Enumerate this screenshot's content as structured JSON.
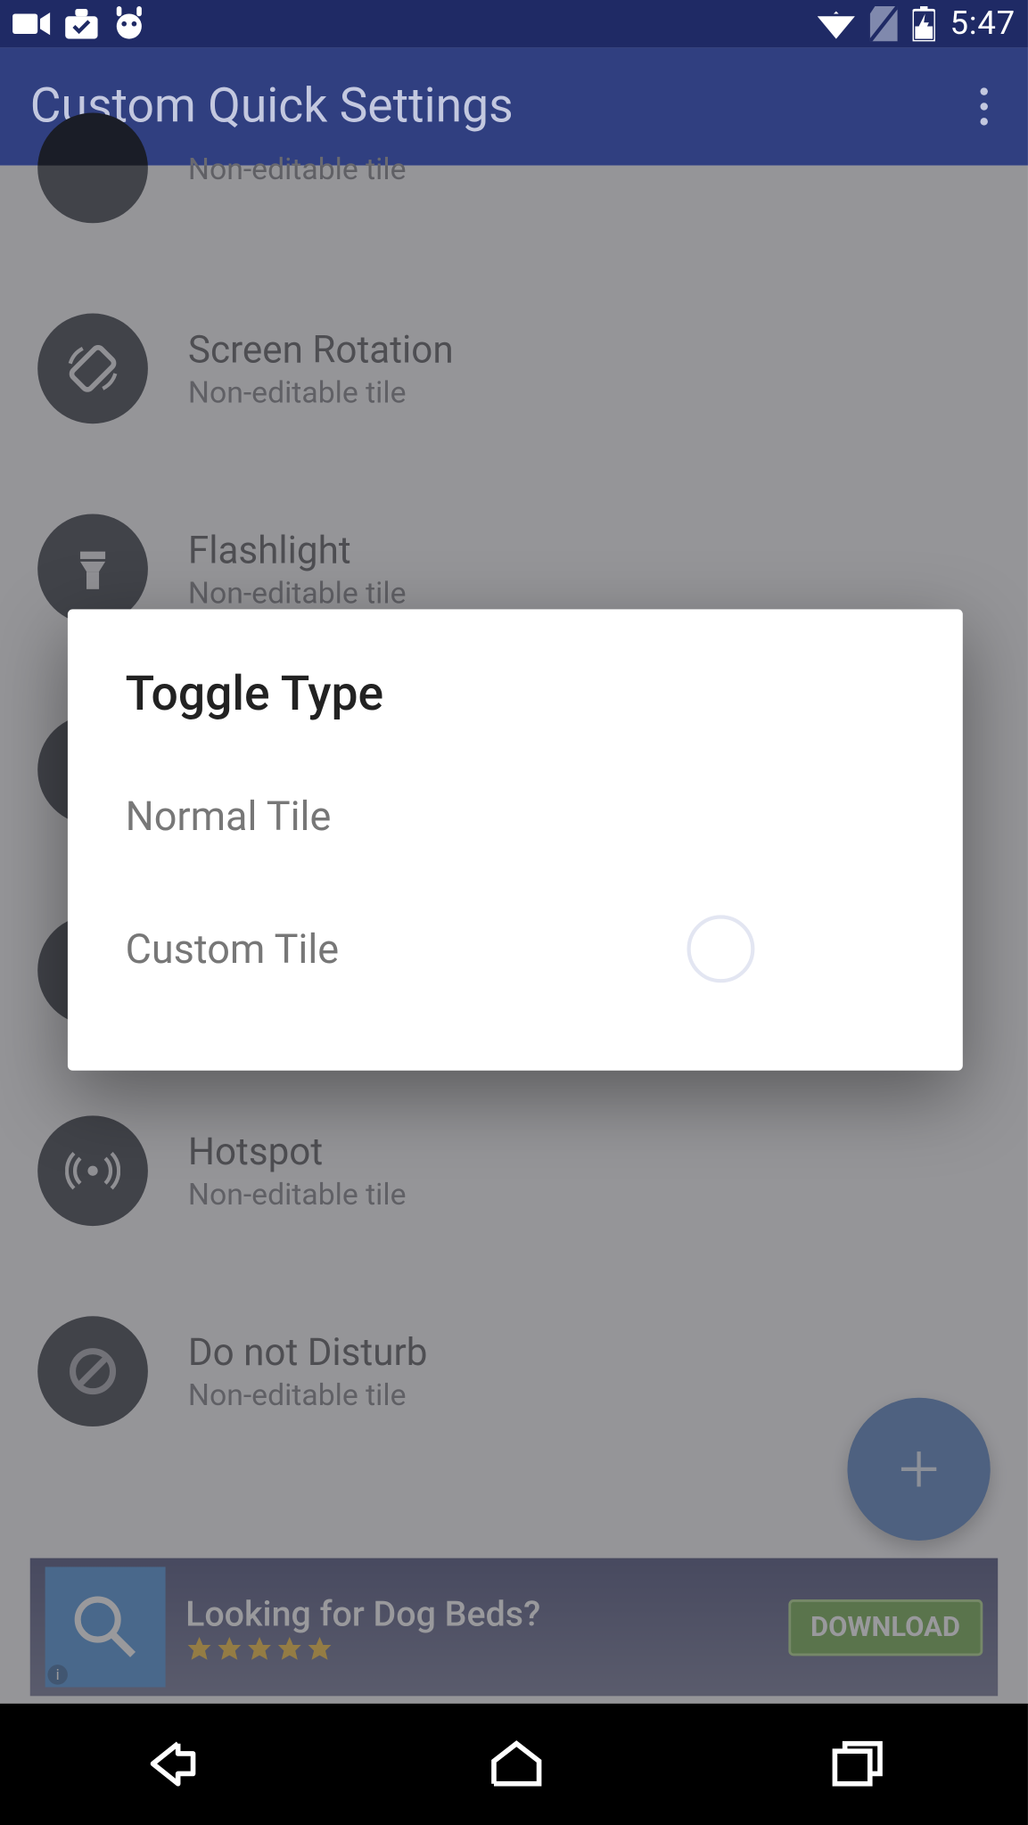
{
  "statusbar": {
    "time": "5:47"
  },
  "appbar": {
    "title": "Custom Quick Settings"
  },
  "tiles": [
    {
      "title": "",
      "sub": "Non-editable tile",
      "icon": "circle"
    },
    {
      "title": "Screen Rotation",
      "sub": "Non-editable tile",
      "icon": "rotate"
    },
    {
      "title": "Flashlight",
      "sub": "Non-editable tile",
      "icon": "flashlight"
    },
    {
      "title": "",
      "sub": "",
      "icon": "circle"
    },
    {
      "title": "",
      "sub": "",
      "icon": "circle"
    },
    {
      "title": "Hotspot",
      "sub": "Non-editable tile",
      "icon": "hotspot"
    },
    {
      "title": "Do not Disturb",
      "sub": "Non-editable tile",
      "icon": "dnd"
    }
  ],
  "dialog": {
    "title": "Toggle Type",
    "options": [
      "Normal Tile",
      "Custom Tile"
    ]
  },
  "ad": {
    "title": "Looking for Dog Beds?",
    "button": "DOWNLOAD"
  }
}
